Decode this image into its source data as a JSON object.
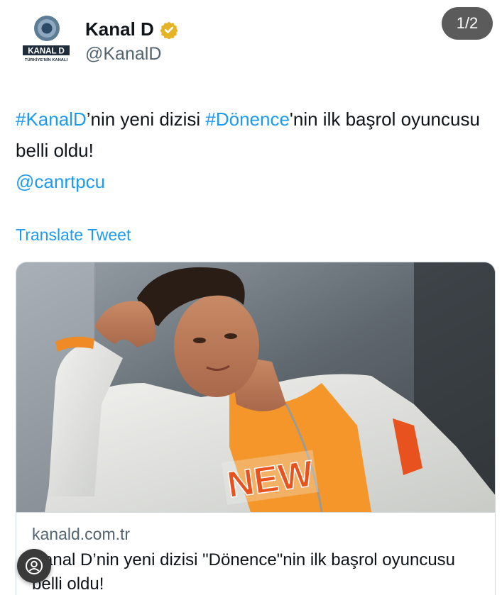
{
  "account": {
    "display_name": "Kanal D",
    "handle": "@KanalD",
    "logo_text": "KANAL D",
    "logo_tagline": "TÜRKİYE'NİN KANALI",
    "verified_icon": "verified-badge-icon",
    "verified_color": "#e6b325"
  },
  "media_counter": "1/2",
  "tweet": {
    "hashtag_1": "#KanalD",
    "text_1": "’nin yeni dizisi ",
    "hashtag_2": "#Dönence",
    "text_2": "'nin ilk başrol oyuncusu belli oldu!",
    "mention": "@canrtpcu"
  },
  "translate_label": "Translate Tweet",
  "card": {
    "domain": "kanald.com.tr",
    "title": "Kanal D’nin yeni dizisi \"Dönence\"nin ilk başrol oyuncusu belli oldu!",
    "jacket_lettering": "NEW"
  },
  "colors": {
    "link": "#1d9bf0",
    "secondary_text": "#536471"
  }
}
